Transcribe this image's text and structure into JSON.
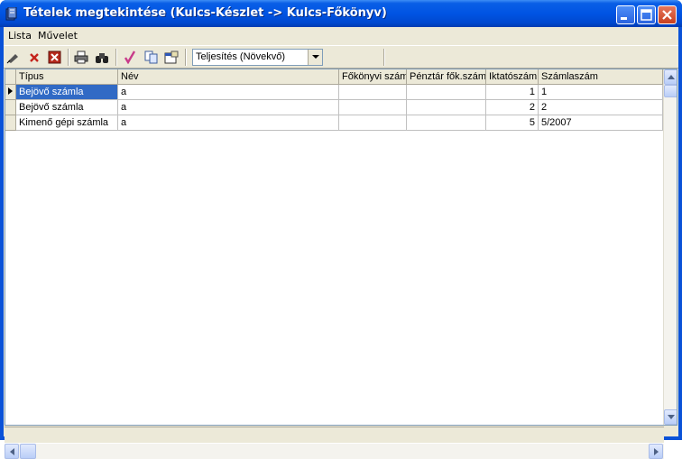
{
  "window": {
    "title": "Tételek megtekintése (Kulcs-Készlet -> Kulcs-Főkönyv)"
  },
  "menu": [
    {
      "label": "Lista"
    },
    {
      "label": "Művelet"
    }
  ],
  "toolbar": {
    "sort_combo_value": "Teljesítés (Növekvő)"
  },
  "grid": {
    "columns": [
      "Típus",
      "Név",
      "Főkönyvi szám",
      "Pénztár fők.szám",
      "Iktatószám",
      "Számlaszám"
    ],
    "rows": [
      {
        "tipus": "Bejövő számla",
        "nev": "a",
        "fokonyvi": "",
        "penztar": "",
        "iktato": "1",
        "szamla": "1"
      },
      {
        "tipus": "Bejövő számla",
        "nev": "a",
        "fokonyvi": "",
        "penztar": "",
        "iktato": "2",
        "szamla": "2"
      },
      {
        "tipus": "Kimenő gépi számla",
        "nev": "a",
        "fokonyvi": "",
        "penztar": "",
        "iktato": "5",
        "szamla": "5/2007"
      }
    ]
  },
  "colors": {
    "titlebar": "#0054e3",
    "selection": "#316ac5",
    "face": "#ece9d8"
  }
}
